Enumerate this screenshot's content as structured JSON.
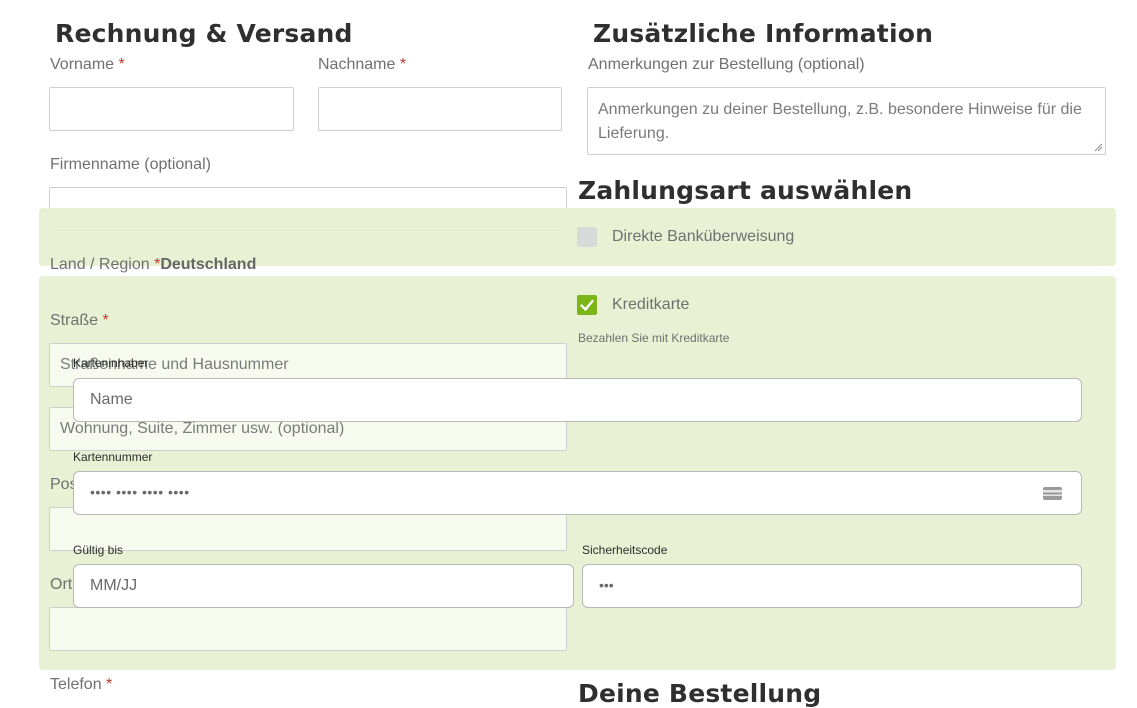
{
  "billing": {
    "heading": "Rechnung & Versand",
    "first_name_label": "Vorname",
    "last_name_label": "Nachname",
    "required_mark": "*",
    "company_label": "Firmenname (optional)",
    "country_label": "Land / Region",
    "country_value": "Deutschland",
    "street_label": "Straße",
    "street_placeholder": "Straßenname und Hausnummer",
    "apartment_placeholder": "Wohnung, Suite, Zimmer usw. (optional)",
    "postcode_label": "Pos",
    "city_label": "Ort",
    "phone_label": "Telefon"
  },
  "additional": {
    "heading": "Zusätzliche Information",
    "notes_label": "Anmerkungen zur Bestellung (optional)",
    "notes_placeholder": "Anmerkungen zu deiner Bestellung, z.B. besondere Hinweise für die Lieferung."
  },
  "payment": {
    "heading": "Zahlungsart auswählen",
    "bank_transfer_label": "Direkte Banküberweisung",
    "bank_transfer_checked": false,
    "credit_card_label": "Kreditkarte",
    "credit_card_checked": true,
    "credit_card_description": "Bezahlen Sie mit Kreditkarte",
    "card": {
      "holder_label": "Karteninhaber",
      "holder_placeholder": "Name",
      "number_label": "Kartennummer",
      "number_placeholder": "•••• •••• •••• ••••",
      "expiry_label": "Gültig bis",
      "expiry_placeholder": "MM/JJ",
      "cvc_label": "Sicherheitscode",
      "cvc_placeholder": "•••",
      "card_icon": "credit-card-icon"
    }
  },
  "order": {
    "heading": "Deine Bestellung"
  },
  "colors": {
    "accent_green": "#7cb518",
    "panel_green": "#e6f0d0",
    "required_red": "#c0392b"
  }
}
